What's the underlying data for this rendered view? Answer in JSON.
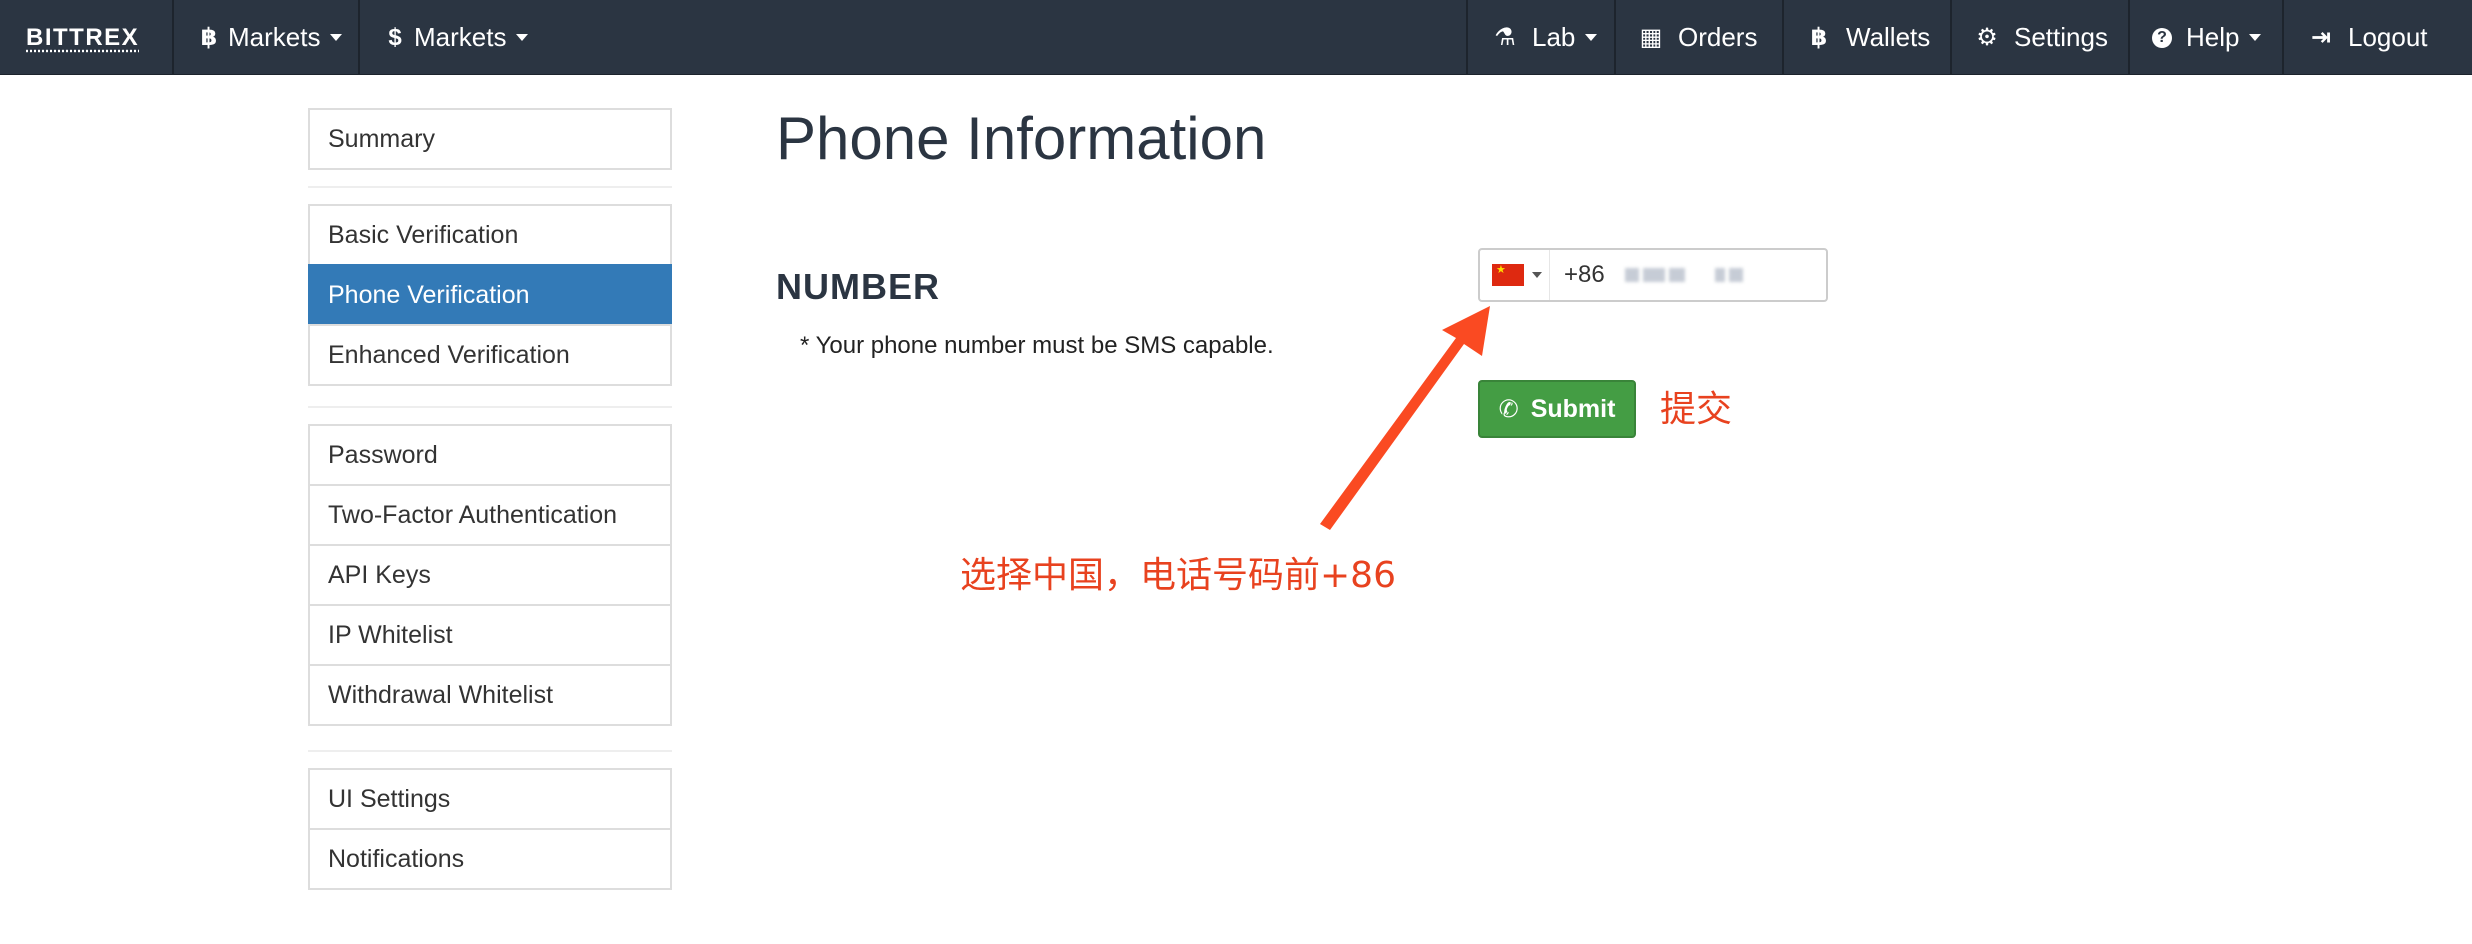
{
  "navbar": {
    "brand": "BITTREX",
    "left_menus": [
      {
        "label": "Markets",
        "icon": "bitcoin-icon",
        "glyph": "฿"
      },
      {
        "label": "Markets",
        "icon": "dollar-icon",
        "glyph": "$"
      }
    ],
    "right_menus": [
      {
        "label": "Lab",
        "icon": "flask-icon",
        "glyph": "⚗"
      },
      {
        "label": "Orders",
        "icon": "calendar-icon",
        "glyph": "▦"
      },
      {
        "label": "Wallets",
        "icon": "bitcoin-icon",
        "glyph": "฿"
      },
      {
        "label": "Settings",
        "icon": "gear-icon",
        "glyph": "⚙"
      },
      {
        "label": "Help",
        "icon": "question-icon",
        "glyph": "?"
      },
      {
        "label": "Logout",
        "icon": "logout-icon",
        "glyph": "⇥"
      }
    ]
  },
  "sidebar": {
    "groups": [
      [
        "Summary"
      ],
      [
        "Basic Verification",
        "Phone Verification",
        "Enhanced Verification"
      ],
      [
        "Password",
        "Two-Factor Authentication",
        "API Keys",
        "IP Whitelist",
        "Withdrawal Whitelist"
      ],
      [
        "UI Settings",
        "Notifications"
      ]
    ],
    "active": "Phone Verification"
  },
  "main": {
    "title": "Phone Information",
    "field_label": "NUMBER",
    "help_text": "* Your phone number must be SMS capable.",
    "phone": {
      "country_flag": "china-flag-icon",
      "dial_code": "+86"
    },
    "submit_label": "Submit"
  },
  "annotations": {
    "submit_note": "提交",
    "country_note": "选择中国，电话号码前+86"
  },
  "colors": {
    "navbar_bg": "#2b3542",
    "active_item": "#337ab7",
    "submit_green": "#449d44",
    "annotation_red": "#e8421f"
  }
}
